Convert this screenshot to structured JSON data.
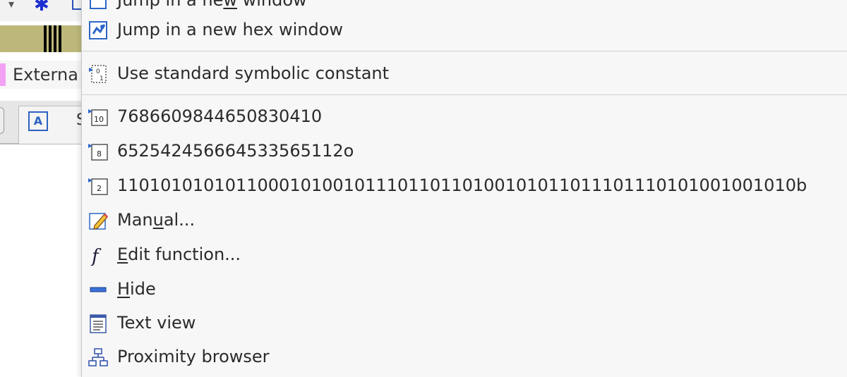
{
  "background": {
    "legend_text": "Externa",
    "tab_text": "S"
  },
  "menu": {
    "items": [
      {
        "id": "jump-new-window",
        "before": "Jump in a ne",
        "mnemonic": "w",
        "after": " window",
        "icon": "jump-window-icon"
      },
      {
        "id": "jump-new-hex-window",
        "before": "Jump in a new hex window",
        "mnemonic": "",
        "after": "",
        "icon": "hex-window-icon"
      },
      {
        "id": "use-symbolic-constant",
        "before": "Use standard symbolic constant",
        "mnemonic": "",
        "after": "",
        "icon": "symbolic-constant-icon"
      },
      {
        "id": "decimal-value",
        "before": "768660984465083041",
        "mnemonic": "",
        "after": "0",
        "icon": "decimal-icon"
      },
      {
        "id": "octal-value",
        "before": "65254245666453356511",
        "mnemonic": "",
        "after": "2o",
        "icon": "octal-icon"
      },
      {
        "id": "binary-value",
        "before": "1101010101011000101001011101101101001010110111011101010010010",
        "mnemonic": "",
        "after": "10b",
        "icon": "binary-icon"
      },
      {
        "id": "manual",
        "before": "Man",
        "mnemonic": "u",
        "after": "al...",
        "icon": "pencil-icon"
      },
      {
        "id": "edit-function",
        "before": "",
        "mnemonic": "E",
        "after": "dit function...",
        "icon": "function-icon"
      },
      {
        "id": "hide",
        "before": "",
        "mnemonic": "H",
        "after": "ide",
        "icon": "minus-icon"
      },
      {
        "id": "text-view",
        "before": "Text view",
        "mnemonic": "",
        "after": "",
        "icon": "text-view-icon"
      },
      {
        "id": "proximity-browser",
        "before": "Proximity browser",
        "mnemonic": "",
        "after": "",
        "icon": "proximity-browser-icon"
      }
    ],
    "base_labels": {
      "decimal": "10",
      "octal": "8",
      "binary": "2"
    }
  }
}
